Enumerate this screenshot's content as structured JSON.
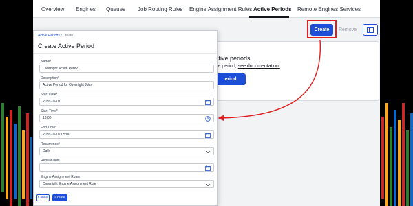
{
  "tabs": [
    {
      "label": "Overview",
      "active": false
    },
    {
      "label": "Engines",
      "active": false
    },
    {
      "label": "Queues",
      "active": false
    },
    {
      "label": "Job Routing Rules",
      "active": false
    },
    {
      "label": "Engine Assignment Rules",
      "active": false
    },
    {
      "label": "Active Periods",
      "active": true
    },
    {
      "label": "Remote Engines Services",
      "active": false
    }
  ],
  "toolbar": {
    "create_label": "Create",
    "remove_label": "Remove",
    "columns_icon": "columns-icon"
  },
  "empty_state": {
    "title": "ctive periods",
    "text": "ve period, ",
    "link": "see documentation.",
    "button_label": "eriod"
  },
  "dialog": {
    "breadcrumb_link": "Active Periods",
    "breadcrumb_sep": "/",
    "breadcrumb_current": "Create",
    "title": "Create Active Period",
    "fields": {
      "name": {
        "label": "Name*",
        "value": "Overnight Active Period"
      },
      "description": {
        "label": "Description*",
        "value": "Active Period for Overnight Jobs"
      },
      "start_date": {
        "label": "Start Date*",
        "value": "2026-05-01",
        "icon": "calendar-icon"
      },
      "start_time": {
        "label": "Start Time*",
        "value": "16:00",
        "icon": "clock-icon"
      },
      "end_time": {
        "label": "End Time*",
        "value": "2026-05-02 05:00",
        "icon": "calendar-icon"
      },
      "recurrence": {
        "label": "Recurrence*",
        "value": "Daily",
        "icon": "chevron-down-icon"
      },
      "repeat_until": {
        "label": "Repeat Until",
        "value": "",
        "icon": "calendar-icon"
      },
      "engine_rules": {
        "label": "Engine Assignment Rules",
        "value": "Overnight Engine Assignment Rule",
        "icon": "chevron-down-icon"
      }
    },
    "cancel_label": "Cancel",
    "create_label": "Create"
  },
  "colors": {
    "primary": "#1d4ed8",
    "highlight": "#e11d1d",
    "background": "#000000"
  }
}
